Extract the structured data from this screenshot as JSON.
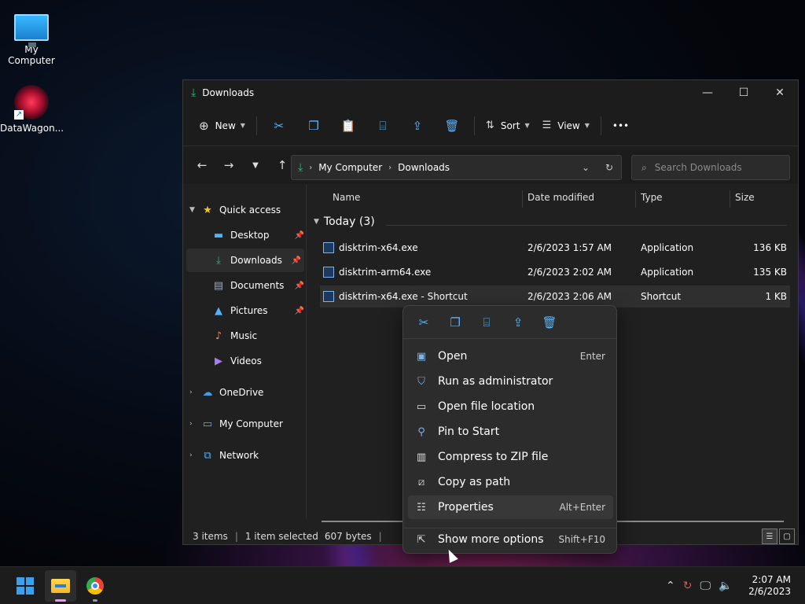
{
  "desktop": {
    "icons": [
      {
        "label": "My Computer",
        "icon": "monitor-icon"
      },
      {
        "label": "DataWagon...",
        "icon": "datawagon-icon"
      }
    ]
  },
  "window": {
    "title": "Downloads",
    "controls": {
      "minimize": "—",
      "maximize": "☐",
      "close": "✕"
    }
  },
  "toolbar": {
    "new_label": "New",
    "sort_label": "Sort",
    "view_label": "View",
    "more_label": "•••"
  },
  "address": {
    "segments": [
      "My Computer",
      "Downloads"
    ],
    "search_placeholder": "Search Downloads"
  },
  "sidebar": {
    "quick_access": "Quick access",
    "items": [
      {
        "label": "Desktop",
        "pinned": true
      },
      {
        "label": "Downloads",
        "pinned": true
      },
      {
        "label": "Documents",
        "pinned": true
      },
      {
        "label": "Pictures",
        "pinned": true
      },
      {
        "label": "Music",
        "pinned": false
      },
      {
        "label": "Videos",
        "pinned": false
      }
    ],
    "roots": [
      "OneDrive",
      "My Computer",
      "Network"
    ]
  },
  "filelist": {
    "columns": [
      "Name",
      "Date modified",
      "Type",
      "Size"
    ],
    "group": "Today (3)",
    "rows": [
      {
        "name": "disktrim-x64.exe",
        "date": "2/6/2023 1:57 AM",
        "type": "Application",
        "size": "136 KB"
      },
      {
        "name": "disktrim-arm64.exe",
        "date": "2/6/2023 2:02 AM",
        "type": "Application",
        "size": "135 KB"
      },
      {
        "name": "disktrim-x64.exe - Shortcut",
        "date": "2/6/2023 2:06 AM",
        "type": "Shortcut",
        "size": "1 KB"
      }
    ]
  },
  "status": {
    "items": "3 items",
    "selected": "1 item selected",
    "size": "607 bytes"
  },
  "context_menu": {
    "items": [
      {
        "label": "Open",
        "shortcut": "Enter"
      },
      {
        "label": "Run as administrator",
        "shortcut": ""
      },
      {
        "label": "Open file location",
        "shortcut": ""
      },
      {
        "label": "Pin to Start",
        "shortcut": ""
      },
      {
        "label": "Compress to ZIP file",
        "shortcut": ""
      },
      {
        "label": "Copy as path",
        "shortcut": ""
      },
      {
        "label": "Properties",
        "shortcut": "Alt+Enter"
      },
      {
        "label": "Show more options",
        "shortcut": "Shift+F10"
      }
    ]
  },
  "taskbar": {
    "time": "2:07 AM",
    "date": "2/6/2023"
  },
  "colors": {
    "accent": "#5fb2f2",
    "window_bg": "#202020"
  }
}
